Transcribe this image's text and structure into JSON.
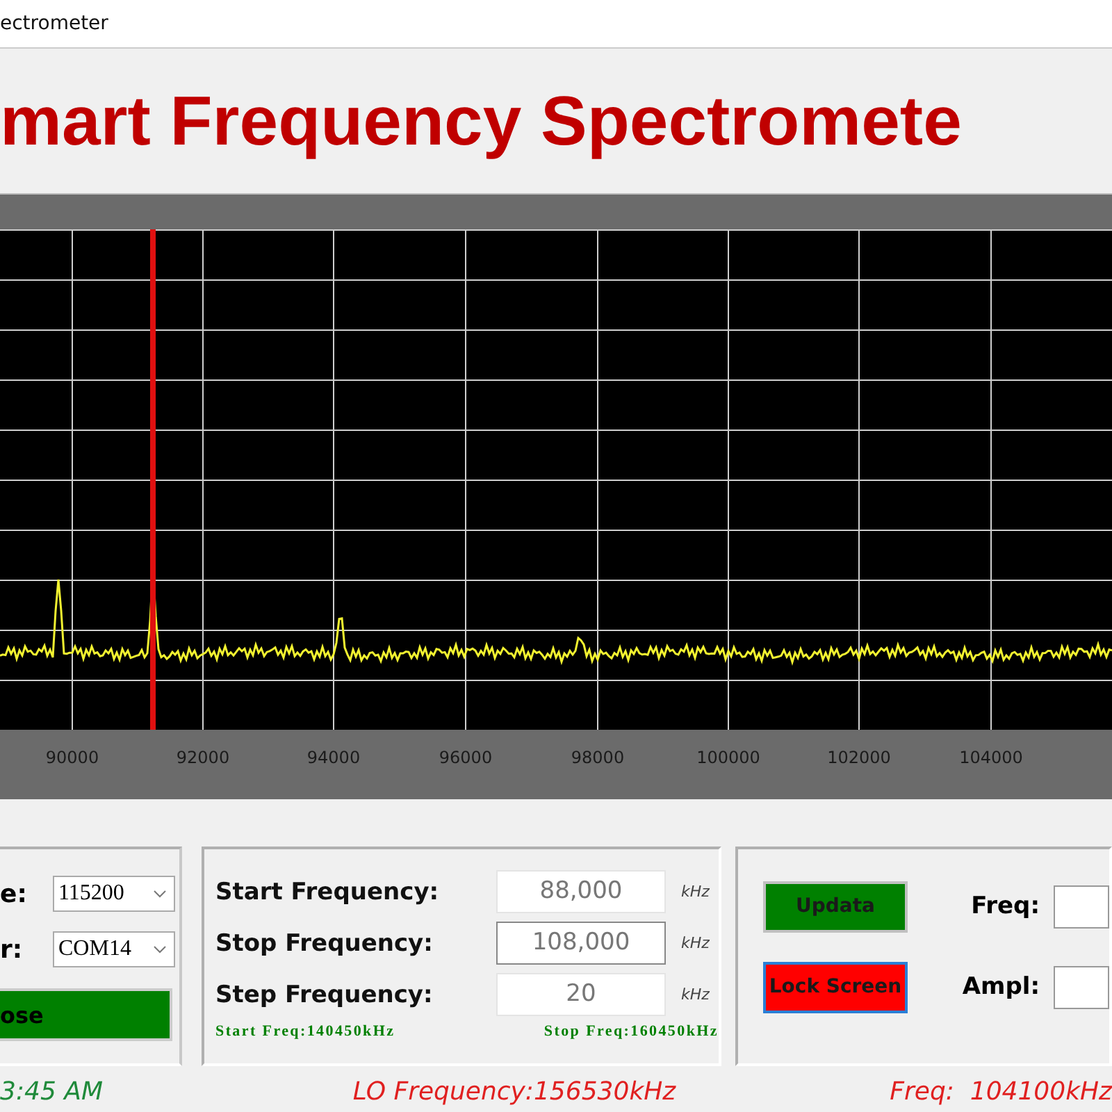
{
  "window": {
    "title": "ectrometer"
  },
  "header": {
    "title": "mart Frequency Spectromete"
  },
  "spectrum": {
    "x_tick_labels": [
      "90000",
      "92000",
      "94000",
      "96000",
      "98000",
      "100000",
      "102000",
      "104000"
    ]
  },
  "serial": {
    "fields": [
      {
        "label": "e:",
        "value": "115200"
      },
      {
        "label": "r:",
        "value": "COM14"
      }
    ],
    "button": "ose"
  },
  "sweep": {
    "fields": [
      {
        "label": "Start Frequency:",
        "value": "88,000",
        "unit": "kHz",
        "focused": false
      },
      {
        "label": "Stop Frequency:",
        "value": "108,000",
        "unit": "kHz",
        "focused": true
      },
      {
        "label": "Step Frequency:",
        "value": "20",
        "unit": "kHz",
        "focused": false
      }
    ],
    "start_note": "Start Freq:140450kHz",
    "stop_note": "Stop Freq:160450kHz"
  },
  "marker": {
    "buttons": [
      {
        "label": "Updata",
        "kind": "green",
        "focused": false
      },
      {
        "label": "Lock Screen",
        "kind": "red",
        "focused": true
      }
    ],
    "readouts": [
      {
        "label": "Freq:"
      },
      {
        "label": "Ampl:"
      }
    ]
  },
  "status_bar": {
    "time": "3:45 AM",
    "lo_frequency": "LO Frequency:156530kHz",
    "reading": "Freq:  104100kHz"
  }
}
